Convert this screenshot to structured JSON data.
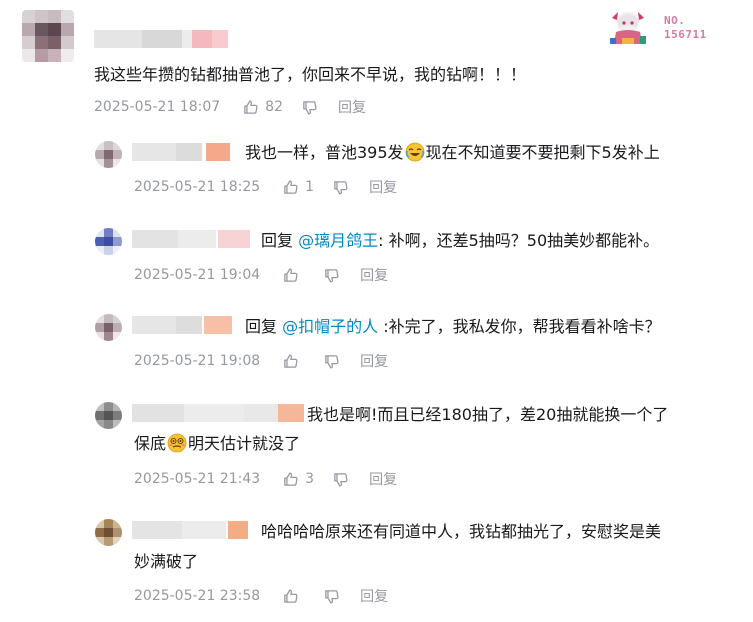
{
  "main": {
    "text": "我这些年攒的钻都抽普池了，你回来不早说，我的钻啊！！！",
    "time": "2025-05-21 18:07",
    "likes": "82",
    "reply_label": "回复",
    "badge": {
      "label": "NO.",
      "number": "156711"
    }
  },
  "replies": [
    {
      "text_a": "我也一样，普池395发",
      "emoji": "crying-laughing-emoji",
      "text_b": "现在不知道要不要把剩下5发补上",
      "time": "2025-05-21 18:25",
      "likes": "1",
      "reply_label": "回复"
    },
    {
      "prefix": "回复 ",
      "mention": "@璃月鸽王",
      "text": ": 补啊，还差5抽吗？50抽美妙都能补。",
      "time": "2025-05-21 19:04",
      "likes": "",
      "reply_label": "回复"
    },
    {
      "prefix": "回复 ",
      "mention": "@扣帽子的人",
      "text": " :补完了，我私发你，帮我看看补啥卡？",
      "time": "2025-05-21 19:08",
      "likes": "",
      "reply_label": "回复"
    },
    {
      "text_a": "我也是啊!而且已经180抽了，差20抽就能换一个了",
      "text_b": "保底",
      "emoji": "dizzy-face-emoji",
      "text_c": "明天估计就没了",
      "time": "2025-05-21 21:43",
      "likes": "3",
      "reply_label": "回复"
    },
    {
      "text_a": "哈哈哈哈原来还有同道中人，我钻都抽光了，安慰奖是美",
      "text_b": "妙满破了",
      "time": "2025-05-21 23:58",
      "likes": "",
      "reply_label": "回复"
    }
  ],
  "colors": {
    "meta_gray": "#9499a0",
    "mention_blue": "#008ac5",
    "text": "#18191c",
    "badge_pink": "#d97aa0"
  }
}
